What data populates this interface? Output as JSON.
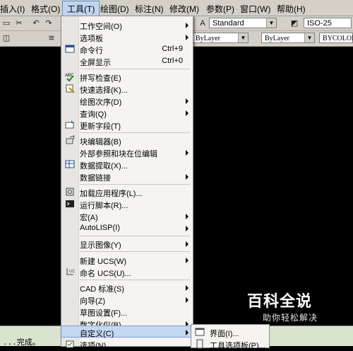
{
  "menubar": {
    "items": [
      {
        "label": "插入(I)"
      },
      {
        "label": "格式(O)"
      },
      {
        "label": "工具(T)"
      },
      {
        "label": "绘图(D)"
      },
      {
        "label": "标注(N)"
      },
      {
        "label": "修改(M)"
      },
      {
        "label": "参数(P)"
      },
      {
        "label": "窗口(W)"
      },
      {
        "label": "帮助(H)"
      }
    ]
  },
  "toolbar": {
    "text_style": "Standard",
    "dim_style": "ISO-25",
    "color": "ByLayer",
    "linetype": "ByLayer",
    "lineweight": "BYCOLOR"
  },
  "tools_menu": {
    "items": [
      {
        "label": "工作空间(O)",
        "submenu": true
      },
      {
        "label": "选项板",
        "submenu": true
      },
      {
        "label": "命令行",
        "shortcut": "Ctrl+9",
        "icon": "command-line-icon"
      },
      {
        "label": "全屏显示",
        "shortcut": "Ctrl+0"
      },
      {
        "label": "拼写检查(E)",
        "icon": "spell-check-icon"
      },
      {
        "label": "快速选择(K)...",
        "icon": "quick-select-icon"
      },
      {
        "label": "绘图次序(D)",
        "submenu": true
      },
      {
        "label": "查询(Q)",
        "submenu": true
      },
      {
        "label": "更新字段(T)",
        "icon": "update-field-icon"
      },
      {
        "label": "块编辑器(B)",
        "icon": "block-editor-icon"
      },
      {
        "label": "外部参照和块在位编辑",
        "submenu": true
      },
      {
        "label": "数据提取(X)...",
        "icon": "data-extraction-icon"
      },
      {
        "label": "数据链接",
        "submenu": true
      },
      {
        "label": "加载应用程序(L)...",
        "icon": "load-app-icon"
      },
      {
        "label": "运行脚本(R)...",
        "icon": "run-script-icon"
      },
      {
        "label": "宏(A)",
        "submenu": true
      },
      {
        "label": "AutoLISP(I)",
        "submenu": true
      },
      {
        "label": "显示图像(Y)",
        "submenu": true
      },
      {
        "label": "新建 UCS(W)",
        "submenu": true
      },
      {
        "label": "命名 UCS(U)...",
        "icon": "named-ucs-icon"
      },
      {
        "label": "CAD 标准(S)",
        "submenu": true
      },
      {
        "label": "向导(Z)",
        "submenu": true
      },
      {
        "label": "草图设置(F)..."
      },
      {
        "label": "数字化仪(B)",
        "submenu": true
      },
      {
        "label": "自定义(C)",
        "submenu": true
      },
      {
        "label": "选项(N)...",
        "icon": "options-icon"
      }
    ]
  },
  "customize_submenu": {
    "items": [
      {
        "label": "界面(I)..."
      },
      {
        "label": "工具选项板(P)..."
      }
    ]
  },
  "command_line": {
    "text": "...完成。"
  },
  "watermark": {
    "title": "百科全说",
    "subtitle": "助你轻松解决"
  }
}
